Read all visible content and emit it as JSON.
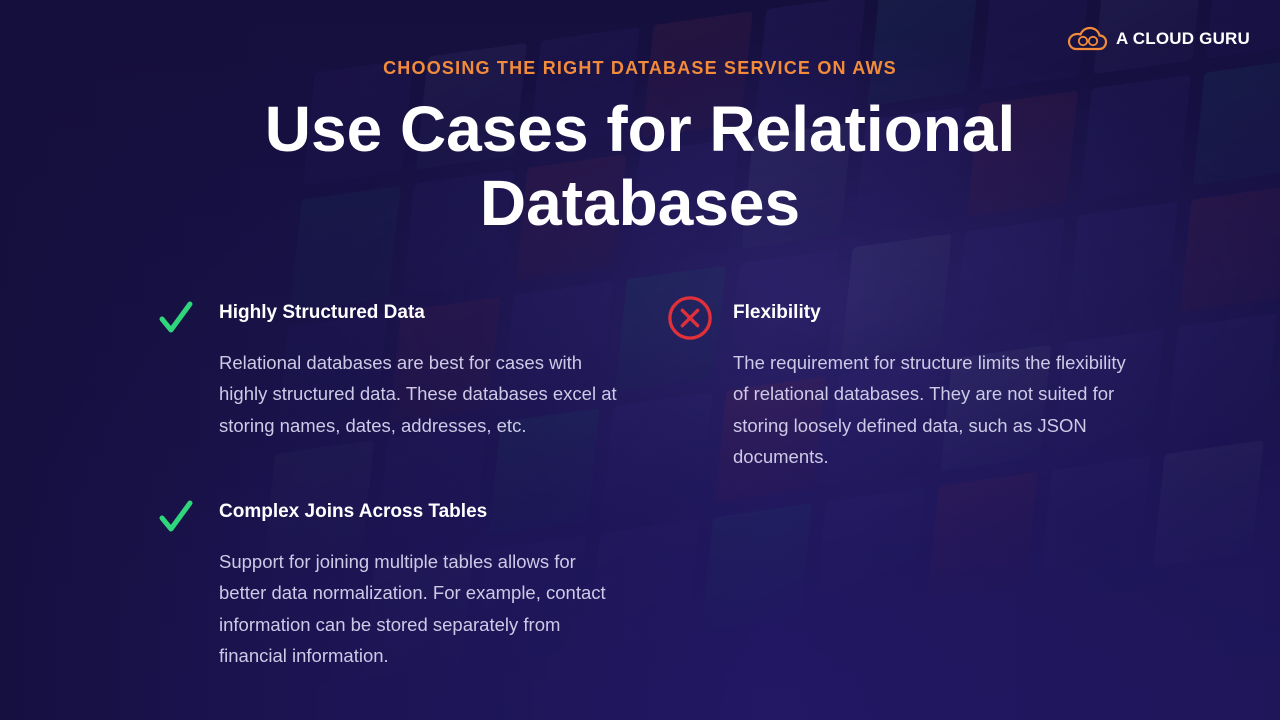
{
  "brand": {
    "name": "A CLOUD GURU",
    "icon": "cloud-logo-icon",
    "accent_color": "#f28b3a"
  },
  "slide": {
    "eyebrow": "CHOOSING THE RIGHT DATABASE SERVICE ON AWS",
    "title": "Use Cases for Relational Databases"
  },
  "pros": [
    {
      "icon": "checkmark-icon",
      "heading": "Highly Structured Data",
      "body": "Relational databases are best for cases with highly structured data. These databases excel at storing names, dates, addresses, etc."
    },
    {
      "icon": "checkmark-icon",
      "heading": "Complex Joins Across Tables",
      "body": "Support for joining multiple tables allows for better data normalization. For example, contact information can be stored separately from financial information."
    }
  ],
  "cons": [
    {
      "icon": "x-circle-icon",
      "heading": "Flexibility",
      "body": "The requirement for structure limits the flexibility of relational databases. They are not suited for storing loosely defined data, such as JSON documents."
    }
  ],
  "colors": {
    "check": "#2fd67b",
    "cross": "#e0303a",
    "body_text": "#cdc9e6",
    "background": "#1c1552"
  }
}
